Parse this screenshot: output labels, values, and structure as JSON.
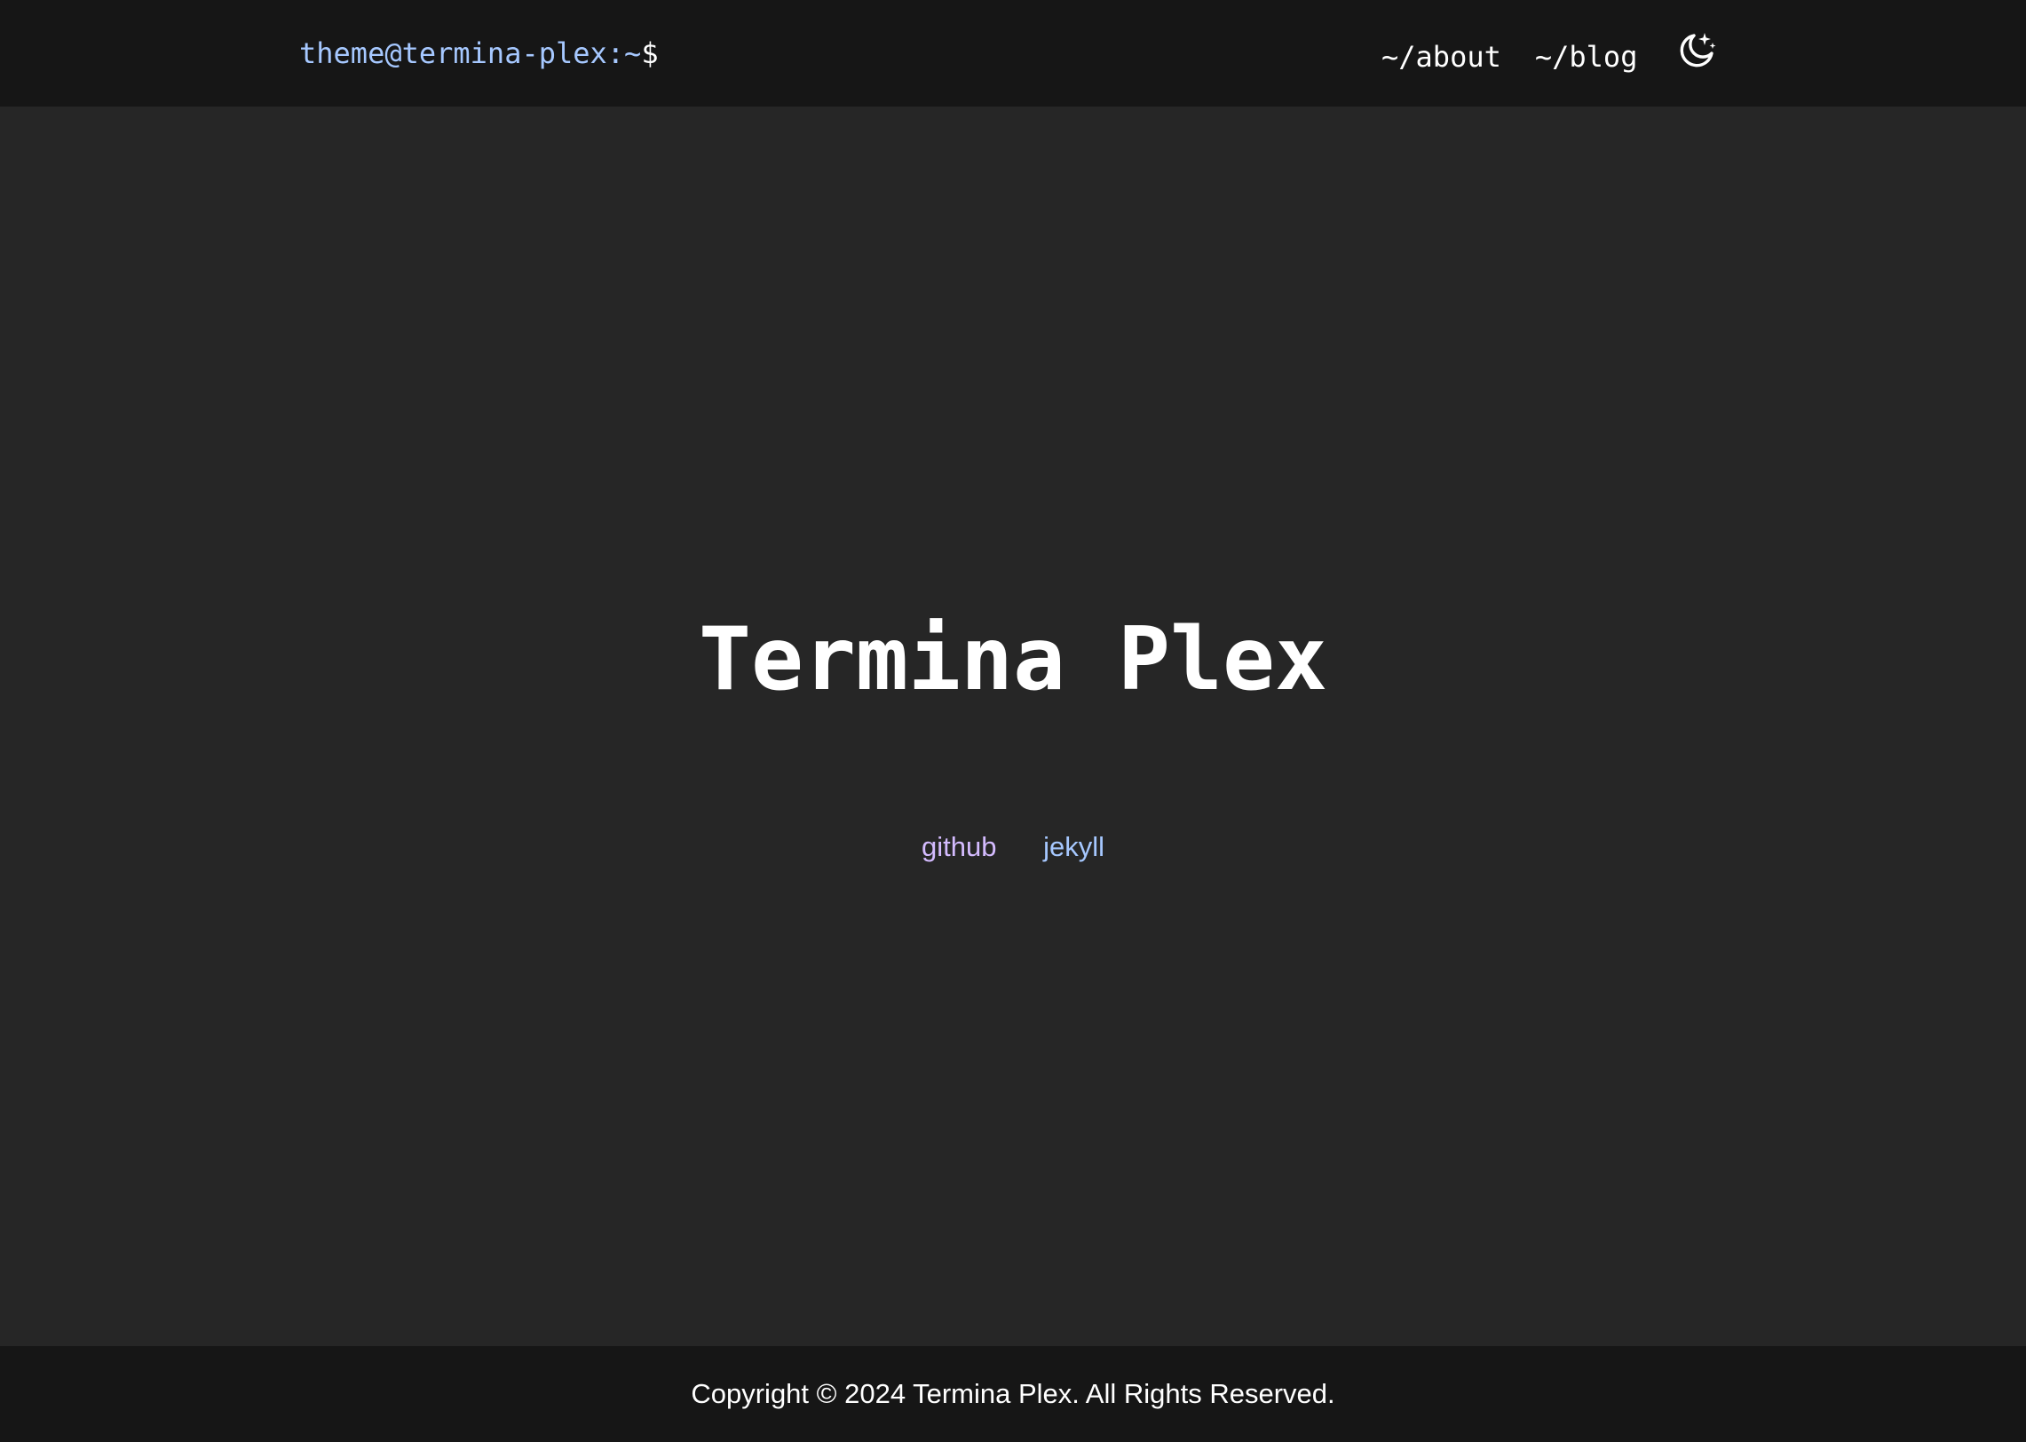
{
  "header": {
    "prompt": {
      "user": "theme@termina-plex",
      "separator": ":",
      "path": "~",
      "symbol": "$"
    },
    "nav": {
      "about_label": "~/about",
      "blog_label": "~/blog"
    },
    "theme_toggle_icon": "moon-stars-icon"
  },
  "main": {
    "title": "Termina Plex",
    "links": {
      "github_label": "github",
      "jekyll_label": "jekyll"
    }
  },
  "footer": {
    "copyright": "Copyright © 2024 Termina Plex. All Rights Reserved."
  },
  "colors": {
    "background": "#262626",
    "bar_background": "#161616",
    "prompt_blue": "#a6c8ff",
    "link_purple": "#d4bbff",
    "link_blue": "#a6c8ff",
    "text": "#ffffff"
  }
}
